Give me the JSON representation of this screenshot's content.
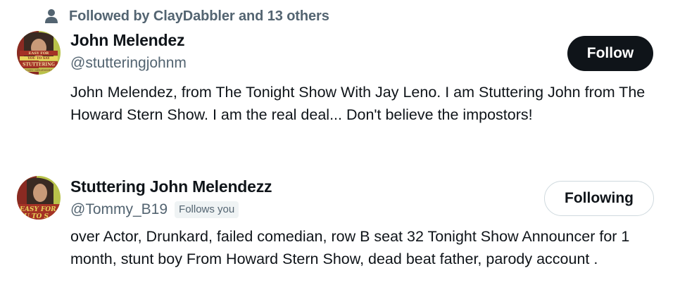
{
  "social_context": {
    "icon": "person-icon",
    "text": "Followed by ClayDabbler and 13 others"
  },
  "users": [
    {
      "avatar_icon": "avatar",
      "avatar_text_lines": [
        "EASY FOR",
        "YOU TO SAY",
        "STUTTERING",
        "JOHN MELENDEZ"
      ],
      "name": "John Melendez",
      "handle": "@stutteringjohnm",
      "follows_you": "",
      "bio": "John Melendez, from The Tonight Show With Jay Leno. I am Stuttering John from The Howard Stern Show. I am the real deal... Don't believe the impostors!",
      "button_label": "Follow"
    },
    {
      "avatar_icon": "avatar",
      "avatar_text_lines": [
        "EASY FOR",
        "OU TO S"
      ],
      "name": "Stuttering John Melendezz",
      "handle": "@Tommy_B19",
      "follows_you": "Follows you",
      "bio": "over Actor, Drunkard, failed comedian, row B seat 32 Tonight Show Announcer for 1 month, stunt boy From Howard Stern Show, dead beat father, parody account .",
      "button_label": "Following"
    }
  ],
  "colors": {
    "primary_text": "#0f1419",
    "secondary_text": "#536471",
    "follow_bg": "#0f1419",
    "following_border": "#cfd9de",
    "badge_bg": "#eff3f4"
  }
}
